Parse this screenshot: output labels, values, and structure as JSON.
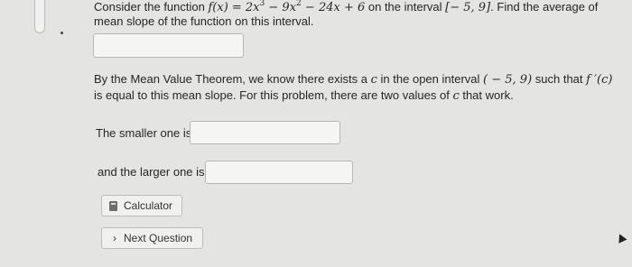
{
  "problem": {
    "intro_before": "Consider the function",
    "function_expr": "f(x) = 2x",
    "exp1": "3",
    "term2": "− 9x",
    "exp2": "2",
    "term3": "− 24x + 6",
    "on_the_interval": "on the interval",
    "interval": "[− 5, 9]",
    "find_avg": ". Find the average of",
    "line2": "mean slope of the function on this interval.",
    "mvt_line1_a": "By the Mean Value Theorem, we know there exists a",
    "mvt_c": "c",
    "mvt_line1_b": "in the open interval",
    "open_interval": "( − 5, 9)",
    "mvt_line1_c": "such that",
    "fprime": "f ′(c)",
    "mvt_line2_a": "is equal to this mean slope. For this problem, there are two values of",
    "mvt_line2_c": "c",
    "mvt_line2_b": "that work.",
    "smaller_label": "The smaller one is",
    "larger_label": "and the larger one is"
  },
  "inputs": {
    "mean_slope_value": "",
    "smaller_value": "",
    "larger_value": ""
  },
  "buttons": {
    "calculator": "Calculator",
    "next_question": "Next Question",
    "next_chevron": "›"
  }
}
